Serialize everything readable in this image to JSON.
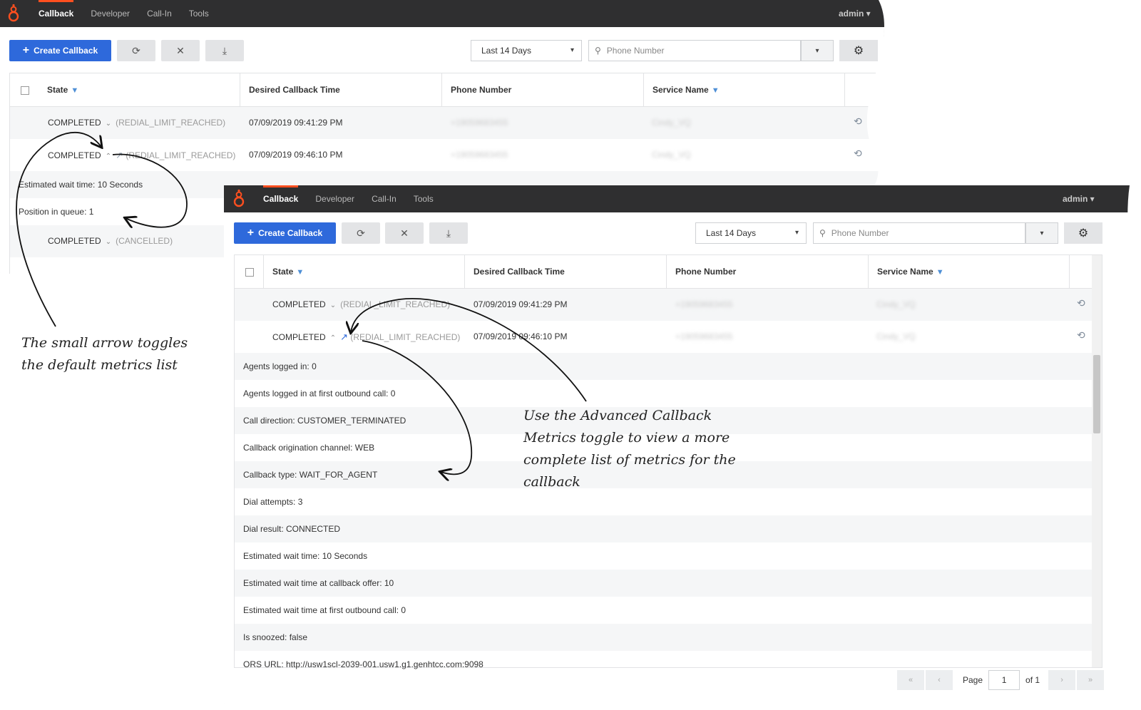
{
  "nav": {
    "items": [
      "Callback",
      "Developer",
      "Call-In",
      "Tools"
    ],
    "active": "Callback",
    "user": "admin ▾"
  },
  "toolbar": {
    "create_label": "Create Callback",
    "date_filter": "Last 14 Days",
    "search_placeholder": "Phone Number"
  },
  "table": {
    "headers": {
      "state": "State",
      "desired_time": "Desired Callback Time",
      "phone": "Phone Number",
      "service": "Service Name"
    }
  },
  "screen1": {
    "rows": [
      {
        "state": "COMPLETED",
        "reason": "(REDIAL_LIMIT_REACHED)",
        "time": "07/09/2019 09:41:29 PM",
        "phone": "+19059683455",
        "service": "Cindy_VQ"
      },
      {
        "state": "COMPLETED",
        "reason": "(REDIAL_LIMIT_REACHED)",
        "time": "07/09/2019 09:46:10 PM",
        "phone": "+19059683455",
        "service": "Cindy_VQ"
      }
    ],
    "metrics": [
      "Estimated wait time: 10 Seconds",
      "Position in queue: 1"
    ],
    "row3": {
      "state": "COMPLETED",
      "reason": "(CANCELLED)"
    }
  },
  "screen2": {
    "rows": [
      {
        "state": "COMPLETED",
        "reason": "(REDIAL_LIMIT_REACHED)",
        "time": "07/09/2019 09:41:29 PM",
        "phone": "+19059683455",
        "service": "Cindy_VQ"
      },
      {
        "state": "COMPLETED",
        "reason": "(REDIAL_LIMIT_REACHED)",
        "time": "07/09/2019 09:46:10 PM",
        "phone": "+19059683455",
        "service": "Cindy_VQ"
      }
    ],
    "metrics": [
      "Agents logged in: 0",
      "Agents logged in at first outbound call: 0",
      "Call direction: CUSTOMER_TERMINATED",
      "Callback origination channel: WEB",
      "Callback type: WAIT_FOR_AGENT",
      "Dial attempts: 3",
      "Dial result: CONNECTED",
      "Estimated wait time: 10 Seconds",
      "Estimated wait time at callback offer: 10",
      "Estimated wait time at first outbound call: 0",
      "Is snoozed: false",
      "ORS URL: http://usw1scl-2039-001.usw1.g1.genhtcc.com:9098"
    ],
    "pager": {
      "page_label": "Page",
      "page": "1",
      "of_label": "of 1"
    }
  },
  "annotations": {
    "left": "The small arrow toggles the default metrics list",
    "right": "Use the Advanced Callback Metrics toggle to view a more complete list of metrics for the callback"
  },
  "colors": {
    "accent": "#2e69db",
    "topbar": "#2f2f30",
    "brand": "#ff4f1f"
  }
}
